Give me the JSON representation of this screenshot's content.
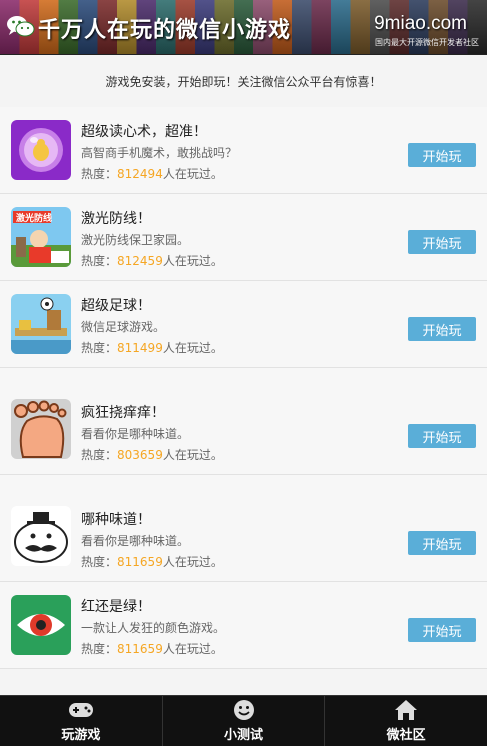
{
  "header": {
    "title": "千万人在玩的微信小游戏",
    "brand_domain": "9miao.com",
    "brand_tagline": "国内最大开源微信开发者社区"
  },
  "notice": "游戏免安装，开始即玩！关注微信公众平台有惊喜！",
  "games": [
    {
      "icon": "crystal-ball-icon",
      "title": "超级读心术，超准！",
      "desc": "高智商手机魔术，敢挑战吗？",
      "heat_prefix": "热度：",
      "heat_count": "812494",
      "heat_suffix": "人在玩过。",
      "button": "开始玩"
    },
    {
      "icon": "laser-defense-icon",
      "title": "激光防线！",
      "desc": "激光防线保卫家园。",
      "heat_prefix": "热度：",
      "heat_count": "812459",
      "heat_suffix": "人在玩过。",
      "button": "开始玩"
    },
    {
      "icon": "soccer-icon",
      "title": "超级足球！",
      "desc": "微信足球游戏。",
      "heat_prefix": "热度：",
      "heat_count": "811499",
      "heat_suffix": "人在玩过。",
      "button": "开始玩"
    },
    {
      "icon": "foot-icon",
      "title": "疯狂挠痒痒！",
      "desc": "看看你是哪种味道。",
      "heat_prefix": "热度：",
      "heat_count": "803659",
      "heat_suffix": "人在玩过。",
      "button": "开始玩"
    },
    {
      "icon": "mustache-face-icon",
      "title": "哪种味道！",
      "desc": "看看你是哪种味道。",
      "heat_prefix": "热度：",
      "heat_count": "811659",
      "heat_suffix": "人在玩过。",
      "button": "开始玩"
    },
    {
      "icon": "eye-icon",
      "title": "红还是绿！",
      "desc": "一款让人发狂的颜色游戏。",
      "heat_prefix": "热度：",
      "heat_count": "811659",
      "heat_suffix": "人在玩过。",
      "button": "开始玩"
    }
  ],
  "nav": {
    "games": {
      "label": "玩游戏",
      "icon": "gamepad-icon"
    },
    "quiz": {
      "label": "小测试",
      "icon": "smiley-icon"
    },
    "community": {
      "label": "微社区",
      "icon": "home-icon"
    }
  },
  "colors": {
    "button": "#5aaed8",
    "heat_count": "#f5a623",
    "nav_bg": "#111111"
  }
}
